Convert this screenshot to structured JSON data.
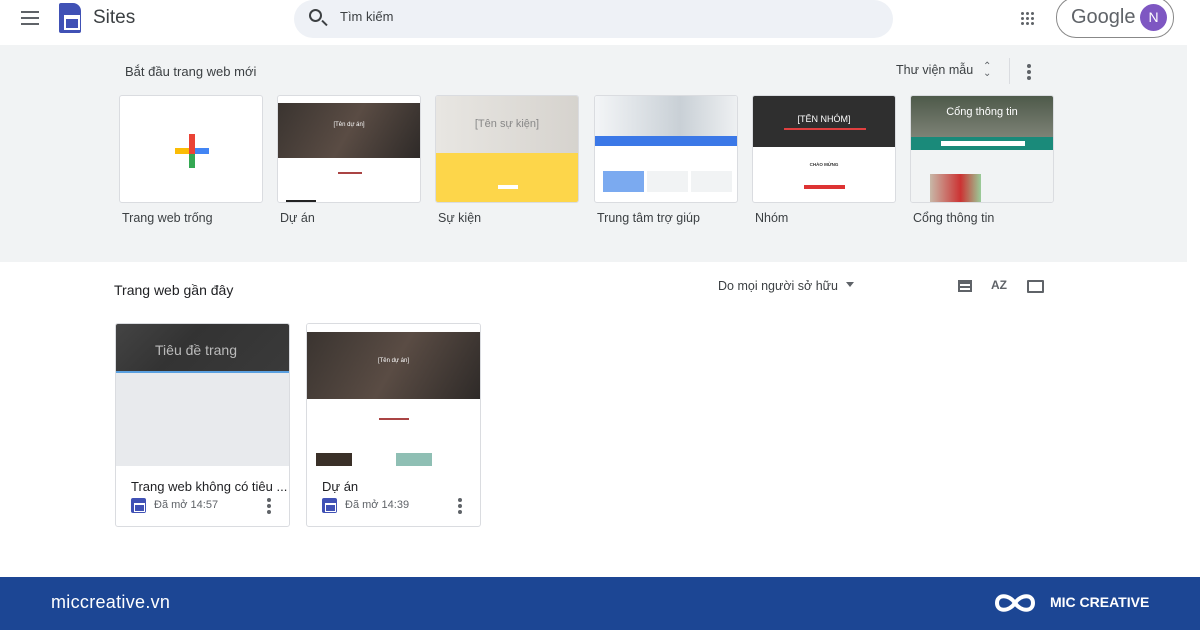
{
  "header": {
    "app_name": "Sites",
    "search_placeholder": "Tìm kiếm",
    "account_brand": "Google",
    "avatar_initial": "N"
  },
  "gallery": {
    "title": "Bắt đầu trang web mới",
    "library_label": "Thư viện mẫu",
    "templates": [
      {
        "label": "Trang web trống"
      },
      {
        "label": "Dự án",
        "thumb_text": "[Tên dự án]"
      },
      {
        "label": "Sự kiện",
        "thumb_text": "[Tên sự kiện]"
      },
      {
        "label": "Trung tâm trợ giúp"
      },
      {
        "label": "Nhóm",
        "thumb_text": "[TÊN NHÓM]",
        "thumb_sub": "CHÀO MỪNG"
      },
      {
        "label": "Cổng thông tin",
        "thumb_text": "Cổng thông tin"
      }
    ]
  },
  "recent": {
    "title": "Trang web gần đây",
    "owner_filter": "Do mọi người sở hữu",
    "sites": [
      {
        "name": "Trang web không có tiêu ...",
        "opened": "Đã mở 14:57",
        "thumb_text": "Tiêu đề trang"
      },
      {
        "name": "Dự án",
        "opened": "Đã mở 14:39",
        "thumb_text": "[Tên dự án]"
      }
    ]
  },
  "footer": {
    "site": "miccreative.vn",
    "brand": "MIC CREATIVE"
  },
  "colors": {
    "sites_blue": "#4051b5",
    "avatar": "#7e57c2",
    "footer": "#1c4694",
    "gallery_bg": "#f1f3f4"
  }
}
